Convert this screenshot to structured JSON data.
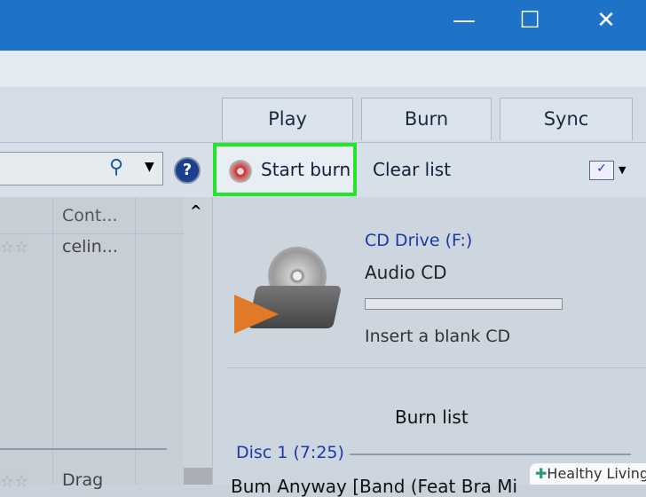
{
  "window": {
    "minimize": "—",
    "maximize": "☐",
    "close": "✕"
  },
  "tabs": [
    "Play",
    "Burn",
    "Sync"
  ],
  "toolbar": {
    "start_burn": "Start burn",
    "clear_list": "Clear list"
  },
  "library": {
    "columns": [
      "Cont..."
    ],
    "rows": [
      {
        "contributor": "celin..."
      },
      {
        "contributor": "Drag"
      }
    ]
  },
  "burn": {
    "drive": "CD Drive (F:)",
    "disc_type": "Audio CD",
    "progress": 0,
    "status": "Insert a blank CD",
    "list_title": "Burn list",
    "disc": "Disc 1 (7:25)",
    "first_track": "Bum Anyway [Band (Feat Bra Mi"
  },
  "watermark": "Healthy Living",
  "colors": {
    "highlight": "#22e62a",
    "link": "#1a3aa8"
  }
}
